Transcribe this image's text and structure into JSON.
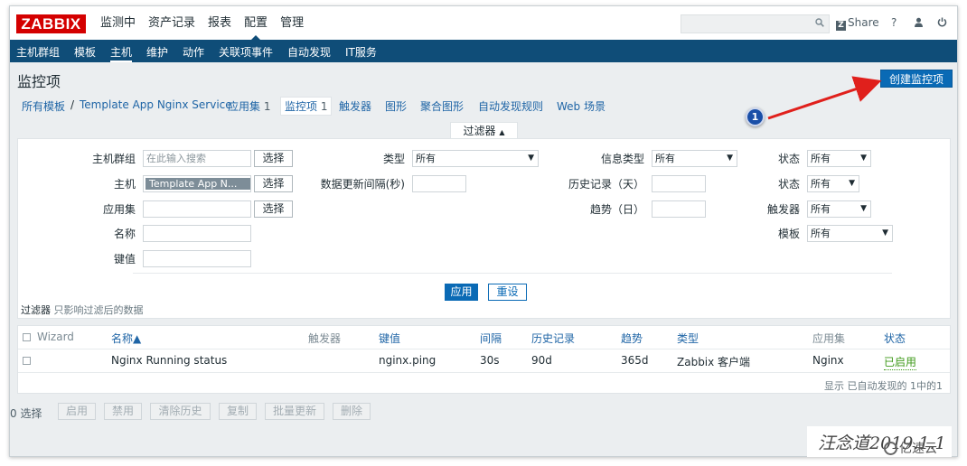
{
  "topbar": {
    "logo": "ZABBIX",
    "menu": [
      "监测中",
      "资产记录",
      "报表",
      "配置",
      "管理"
    ],
    "active_menu": "配置",
    "search_placeholder": "",
    "share_label": "Share",
    "help_icon": "?",
    "user_icon": "user-icon",
    "power_icon": "power-icon"
  },
  "submenu": [
    "主机群组",
    "模板",
    "主机",
    "维护",
    "动作",
    "关联项事件",
    "自动发现",
    "IT服务"
  ],
  "page_title": "监控项",
  "create_button": "创建监控项",
  "breadcrumb": {
    "all_templates": "所有模板",
    "separator": "/",
    "template": "Template App Nginx Service",
    "applications": "应用集",
    "applications_count": "1",
    "items": "监控项",
    "items_count": "1",
    "triggers": "触发器",
    "graphs": "图形",
    "screens": "聚合图形",
    "discovery": "自动发现规则",
    "web": "Web 场景"
  },
  "filter": {
    "tab_label": "过滤器",
    "tab_arrow": "▲",
    "host_group_label": "主机群组",
    "host_group_placeholder": "在此输入搜索",
    "select_button": "选择",
    "host_label": "主机",
    "host_value": "Template App N...",
    "application_label": "应用集",
    "name_label": "名称",
    "key_label": "键值",
    "type_label": "类型",
    "type_value": "所有",
    "interval_label": "数据更新间隔(秒)",
    "info_type_label": "信息类型",
    "info_type_value": "所有",
    "history_label": "历史记录（天）",
    "trends_label": "趋势（日）",
    "state_label": "状态",
    "state_value": "所有",
    "status_label": "状态",
    "status_value": "所有",
    "triggers_label": "触发器",
    "triggers_value": "所有",
    "template_label": "模板",
    "template_value": "所有",
    "apply_button": "应用",
    "reset_button": "重设",
    "note_prefix": "过滤器",
    "note_text": "只影响过滤后的数据"
  },
  "table": {
    "headers": {
      "wizard": "Wizard",
      "name": "名称▲",
      "triggers": "触发器",
      "key": "键值",
      "interval": "间隔",
      "history": "历史记录",
      "trends": "趋势",
      "type": "类型",
      "applications": "应用集",
      "status": "状态"
    },
    "rows": [
      {
        "name": "Nginx Running status",
        "triggers": "",
        "key": "nginx.ping",
        "interval": "30s",
        "history": "90d",
        "trends": "365d",
        "type": "Zabbix 客户端",
        "applications": "Nginx",
        "status": "已启用"
      }
    ],
    "footer": "显示 已自动发现的 1中的1"
  },
  "actions": {
    "selected": "0 选择",
    "buttons": [
      "启用",
      "禁用",
      "清除历史",
      "复制",
      "批量更新",
      "删除"
    ]
  },
  "annotation": {
    "badge_number": "1",
    "arrow_color": "#e0201c"
  },
  "watermark": {
    "signature": "汪念道2019.1.1",
    "site": "亿速云"
  }
}
